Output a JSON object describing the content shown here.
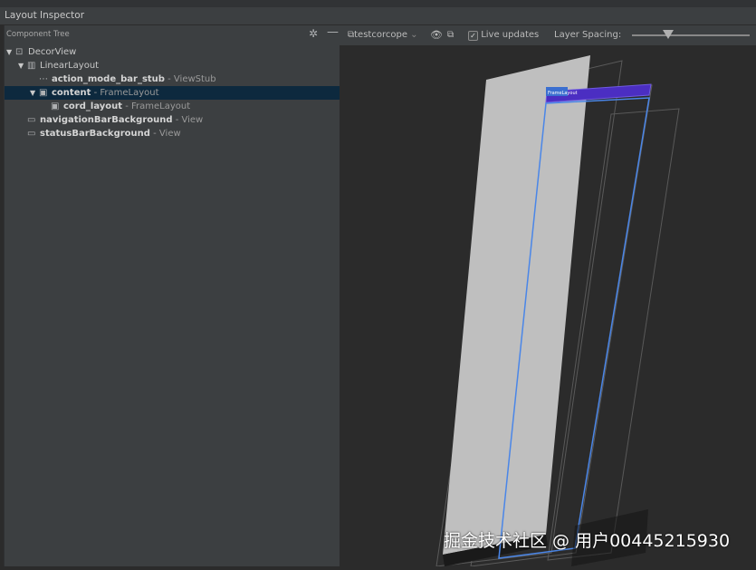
{
  "window": {
    "title": "Layout Inspector"
  },
  "component_tree": {
    "header": "Component Tree",
    "gear_icon": "gear-icon",
    "collapse_icon": "minus-icon",
    "nodes": [
      {
        "name": "DecorView",
        "type": "",
        "depth": 0,
        "expanded": true,
        "bold": false,
        "selected": false,
        "icon": "decor-view-icon"
      },
      {
        "name": "LinearLayout",
        "type": "",
        "depth": 1,
        "expanded": true,
        "bold": false,
        "selected": false,
        "icon": "linear-layout-icon"
      },
      {
        "name": "action_mode_bar_stub",
        "type": " - ViewStub",
        "depth": 2,
        "expanded": null,
        "bold": true,
        "selected": false,
        "icon": "view-stub-icon"
      },
      {
        "name": "content",
        "type": " - FrameLayout",
        "depth": 2,
        "expanded": true,
        "bold": true,
        "selected": true,
        "icon": "frame-layout-icon"
      },
      {
        "name": "cord_layout",
        "type": " - FrameLayout",
        "depth": 3,
        "expanded": null,
        "bold": true,
        "selected": false,
        "icon": "frame-layout-icon"
      },
      {
        "name": "navigationBarBackground",
        "type": " - View",
        "depth": 1,
        "expanded": null,
        "bold": true,
        "selected": false,
        "icon": "view-icon"
      },
      {
        "name": "statusBarBackground",
        "type": " - View",
        "depth": 1,
        "expanded": null,
        "bold": true,
        "selected": false,
        "icon": "view-icon"
      }
    ]
  },
  "toolbar": {
    "process": "testcorcope",
    "live_updates_label": "Live updates",
    "live_updates_checked": true,
    "layer_spacing_label": "Layer Spacing:",
    "layer_spacing_level": 0.3
  },
  "viewport": {
    "selected_label": "FrameLayout",
    "colors": {
      "selection": "#4a86e8",
      "highlight": "#4b2ec2",
      "screen": "#bfbfbf"
    }
  },
  "watermark": "掘金技术社区 @ 用户00445215930"
}
